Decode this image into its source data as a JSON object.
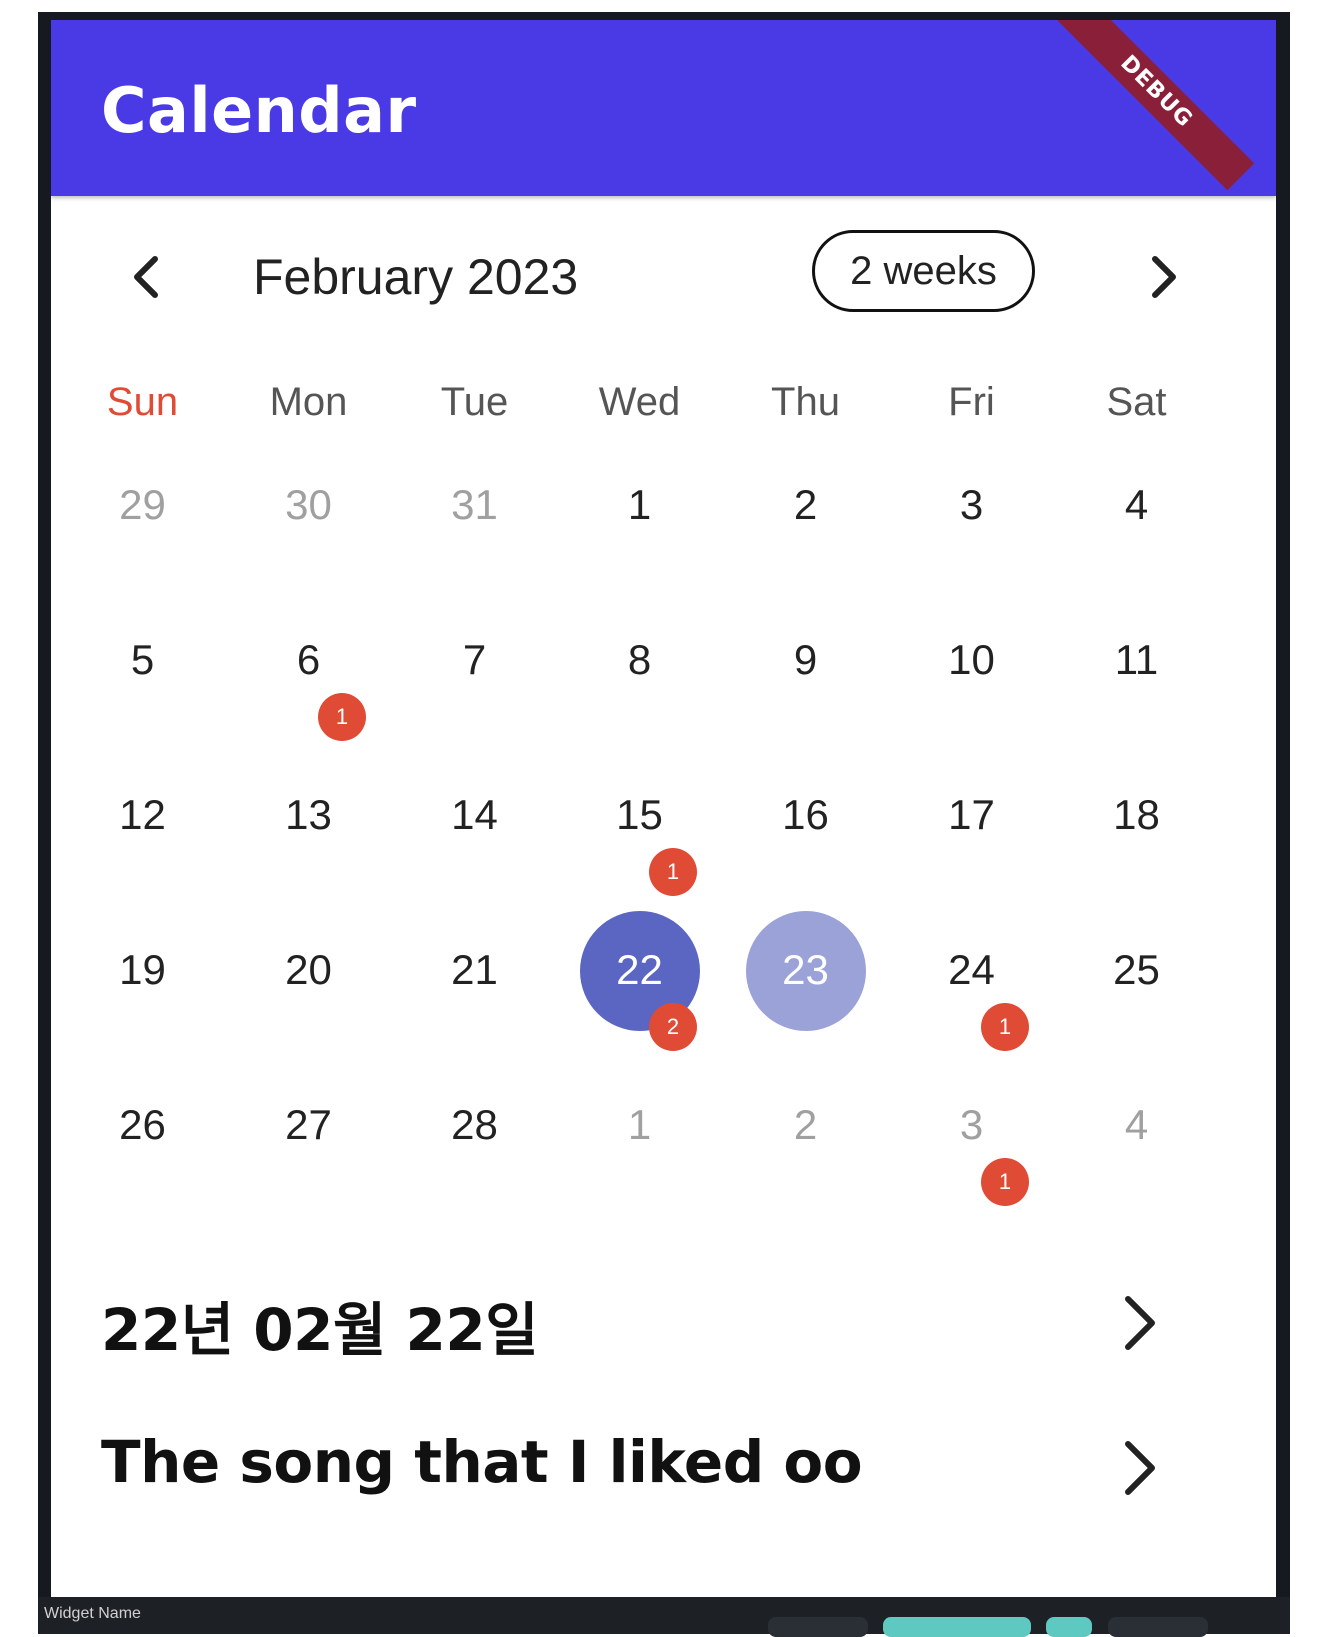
{
  "appbar": {
    "title": "Calendar",
    "debug_banner": "DEBUG",
    "color": "#4a3ae6"
  },
  "calendar_header": {
    "month_label": "February 2023",
    "format_button": "2 weeks"
  },
  "weekdays": [
    "Sun",
    "Mon",
    "Tue",
    "Wed",
    "Thu",
    "Fri",
    "Sat"
  ],
  "weeks": [
    [
      {
        "day": "29",
        "out": true
      },
      {
        "day": "30",
        "out": true
      },
      {
        "day": "31",
        "out": true
      },
      {
        "day": "1"
      },
      {
        "day": "2"
      },
      {
        "day": "3"
      },
      {
        "day": "4"
      }
    ],
    [
      {
        "day": "5"
      },
      {
        "day": "6",
        "badge": "1"
      },
      {
        "day": "7"
      },
      {
        "day": "8"
      },
      {
        "day": "9"
      },
      {
        "day": "10"
      },
      {
        "day": "11"
      }
    ],
    [
      {
        "day": "12"
      },
      {
        "day": "13"
      },
      {
        "day": "14"
      },
      {
        "day": "15",
        "badge": "1"
      },
      {
        "day": "16"
      },
      {
        "day": "17"
      },
      {
        "day": "18"
      }
    ],
    [
      {
        "day": "19"
      },
      {
        "day": "20"
      },
      {
        "day": "21"
      },
      {
        "day": "22",
        "badge": "2",
        "state": "selected"
      },
      {
        "day": "23",
        "state": "today"
      },
      {
        "day": "24",
        "badge": "1"
      },
      {
        "day": "25"
      }
    ],
    [
      {
        "day": "26"
      },
      {
        "day": "27"
      },
      {
        "day": "28"
      },
      {
        "day": "1",
        "out": true
      },
      {
        "day": "2",
        "out": true
      },
      {
        "day": "3",
        "out": true,
        "badge": "1"
      },
      {
        "day": "4",
        "out": true
      }
    ]
  ],
  "events": [
    {
      "title": "22년 02월 22일"
    },
    {
      "title": "The song that I liked oo"
    }
  ],
  "colors": {
    "selected": "#5a66c2",
    "today": "#9aa2d8",
    "badge": "#e04b36",
    "sunday": "#e04b36"
  },
  "bottom_bar": {
    "widget_name": "Widget Name"
  }
}
